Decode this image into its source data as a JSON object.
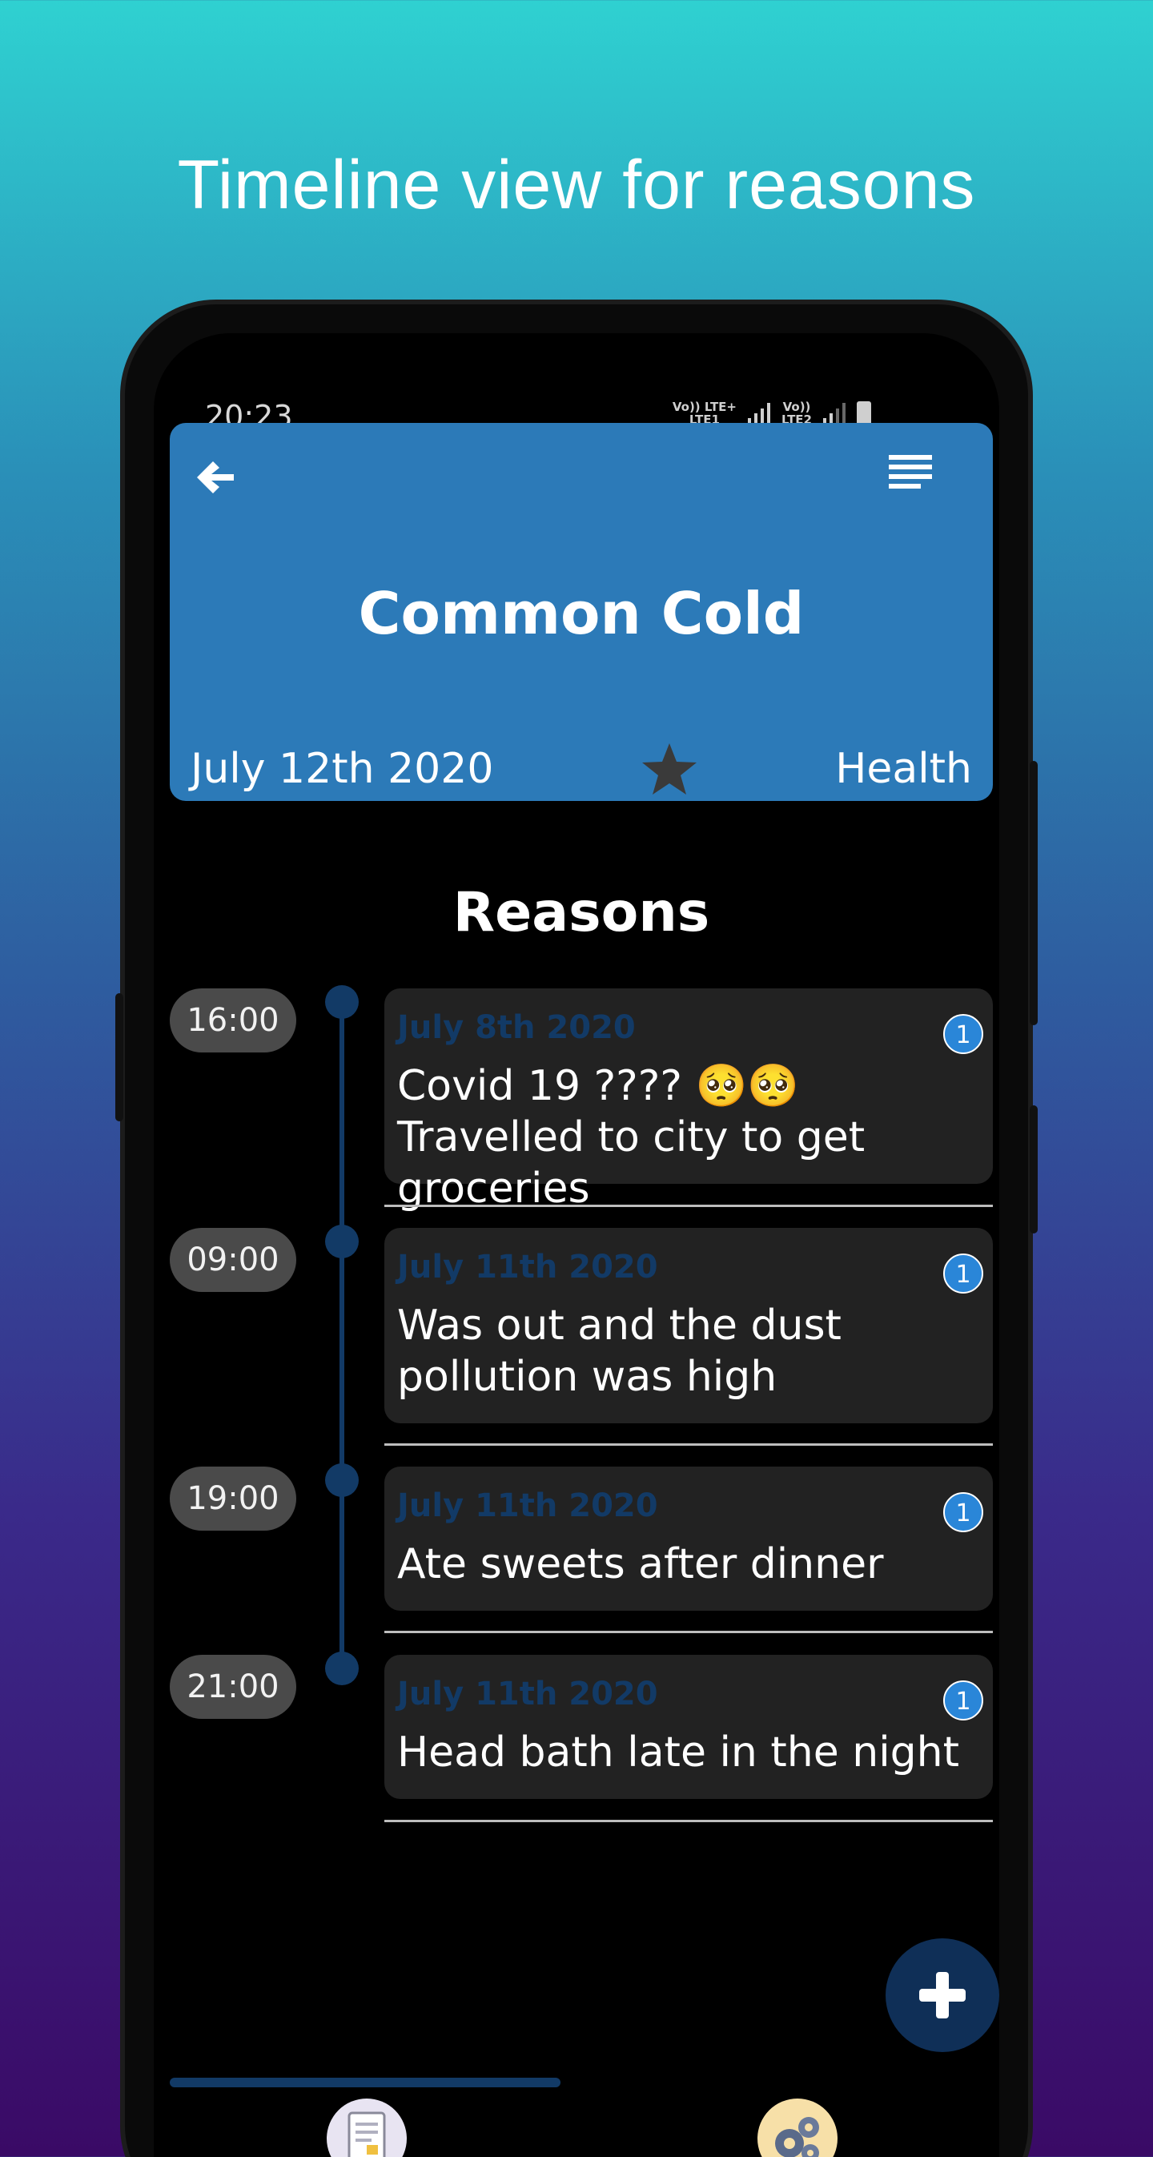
{
  "promo": {
    "title": "Timeline view for reasons"
  },
  "status_bar": {
    "time": "20:23",
    "net1_top": "Vo)) LTE+",
    "net1_bottom": "LTE1",
    "net2_top": "Vo))",
    "net2_bottom": "LTE2"
  },
  "header": {
    "title": "Common Cold",
    "date": "July 12th 2020",
    "category": "Health",
    "starred": true,
    "back_icon": "back-arrow-icon",
    "menu_icon": "menu-lines-icon"
  },
  "section": {
    "title": "Reasons"
  },
  "reasons": [
    {
      "time": "16:00",
      "date": "July 8th 2020",
      "text": "Covid 19 ???? 🥺🥺 Travelled to city to get groceries",
      "count": "1"
    },
    {
      "time": "09:00",
      "date": "July 11th 2020",
      "text": "Was out and the dust pollution was high",
      "count": "1"
    },
    {
      "time": "19:00",
      "date": "July 11th 2020",
      "text": "Ate sweets after dinner",
      "count": "1"
    },
    {
      "time": "21:00",
      "date": "July 11th 2020",
      "text": "Head bath late in the night",
      "count": "1"
    }
  ],
  "fab": {
    "icon": "plus-icon"
  },
  "bottom_nav": {
    "items": [
      "document-icon",
      "gears-icon"
    ],
    "active_index": 0
  },
  "colors": {
    "header": "#2c7ab8",
    "accent_dark": "#123a66",
    "badge": "#2a86d8",
    "card": "#222222"
  }
}
